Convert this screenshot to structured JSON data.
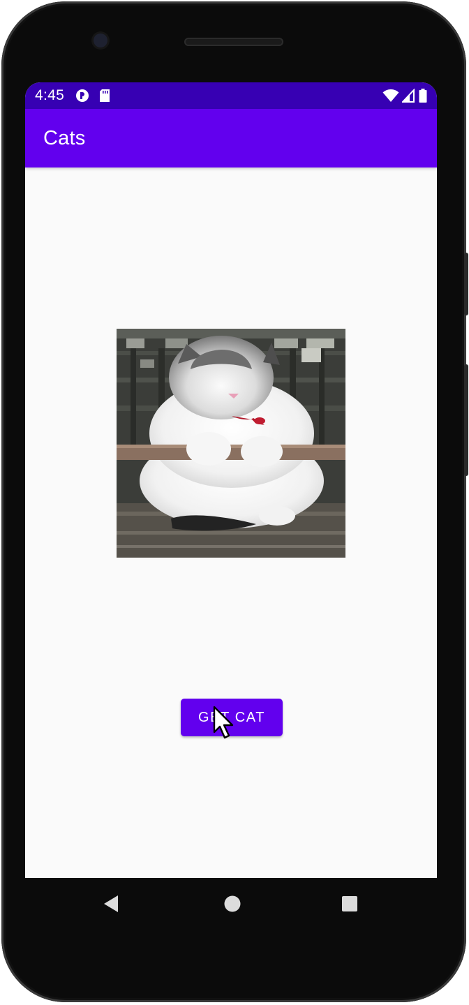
{
  "status_bar": {
    "time": "4:45",
    "left_icons": [
      "app-notification-icon",
      "sd-card-icon"
    ],
    "right_icons": [
      "wifi-icon",
      "cell-signal-icon",
      "battery-icon"
    ],
    "background": "#3700b3"
  },
  "app_bar": {
    "title": "Cats",
    "background": "#6200ee"
  },
  "main": {
    "image": {
      "icon": "cat-photo"
    },
    "get_cat_button": {
      "label": "GET CAT",
      "background": "#6200ee"
    }
  },
  "navigation_bar": {
    "buttons": [
      "back-icon",
      "home-icon",
      "recents-icon"
    ]
  }
}
